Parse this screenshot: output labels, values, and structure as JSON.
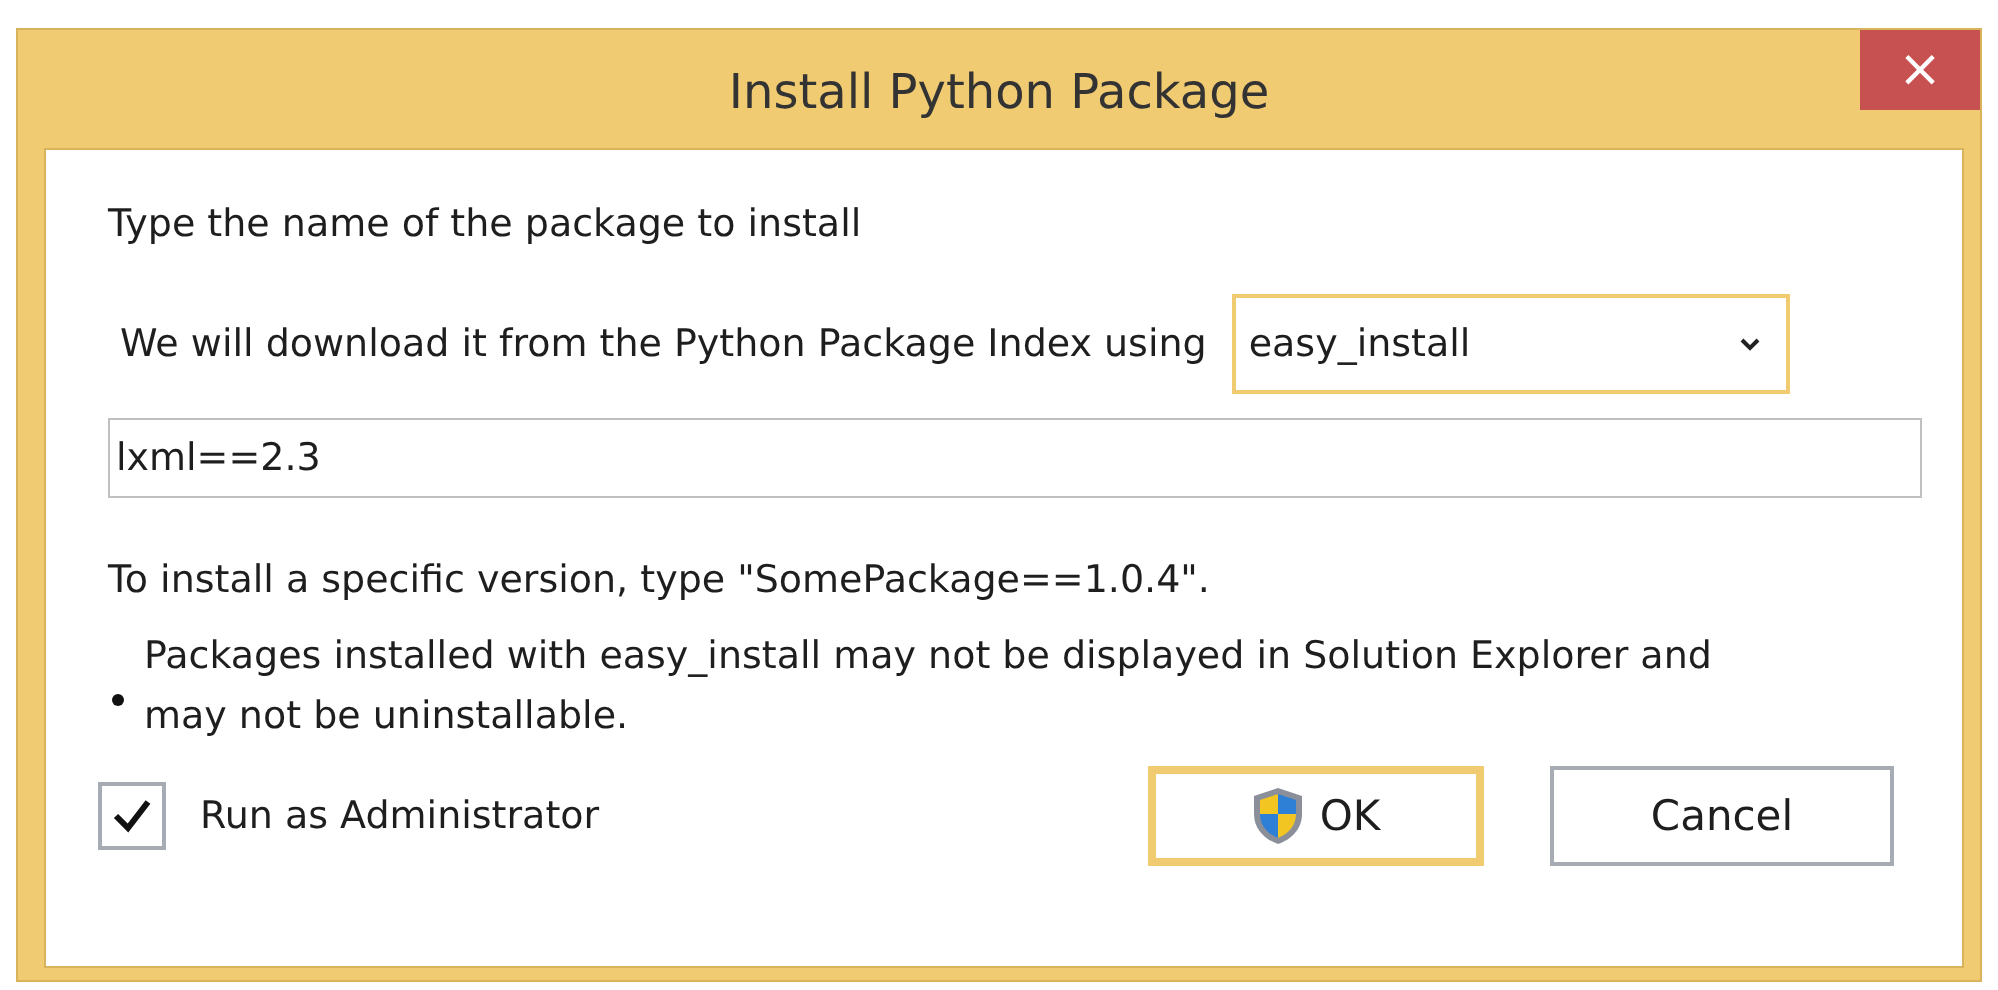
{
  "window": {
    "title": "Install Python Package",
    "close": "×"
  },
  "instruction": "Type the name of the package to install",
  "source": {
    "label": "We will download it from the Python Package Index using",
    "dropdown": {
      "value": "easy_install",
      "focused": true
    }
  },
  "package_field": {
    "value": "lxml==2.3"
  },
  "hint": "To install a specific version, type \"SomePackage==1.0.4\".",
  "notes": [
    "Packages installed with easy_install may not be displayed in Solution Explorer and may not be uninstallable."
  ],
  "run_as_admin": {
    "label": "Run as Administrator",
    "checked": true
  },
  "buttons": [
    {
      "label": "OK",
      "default": true,
      "shield": true
    },
    {
      "label": "Cancel",
      "default": false,
      "shield": false
    }
  ]
}
